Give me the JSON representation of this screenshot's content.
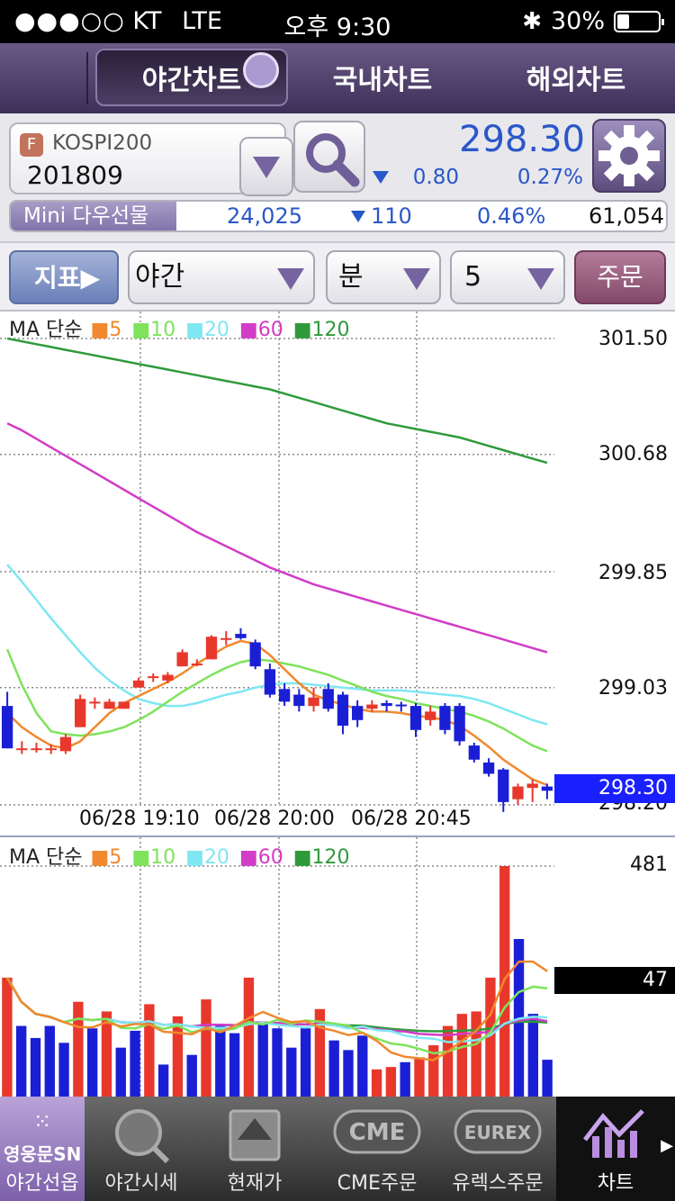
{
  "status": {
    "carrier": "KT",
    "network": "LTE",
    "time": "오후 9:30",
    "battery": "30%",
    "battery_level": 0.3
  },
  "tabs": [
    {
      "label": "야간차트",
      "active": true
    },
    {
      "label": "국내차트",
      "active": false
    },
    {
      "label": "해외차트",
      "active": false
    }
  ],
  "quote": {
    "badge": "F",
    "market": "KOSPI200",
    "code": "201809",
    "price": "298.30",
    "change": "0.80",
    "change_pct": "0.27%",
    "direction": "down",
    "ticker": {
      "label": "Mini 다우선물",
      "value": "24,025",
      "change": "110",
      "change_pct": "0.46%",
      "volume": "61,054"
    }
  },
  "toolbar": {
    "indicator": "지표▶",
    "session": "야간",
    "unit": "분",
    "interval": "5",
    "order": "주문"
  },
  "colors": {
    "up": "#e8382c",
    "down": "#1a1fd6",
    "ma5": "#f0892e",
    "ma10": "#7ee35b",
    "ma20": "#7fe7f2",
    "ma60": "#d23cc7",
    "ma120": "#2f9a3c",
    "current": "#1a1fff"
  },
  "price_chart": {
    "legend": {
      "title": "MA 단순",
      "items": [
        "5",
        "10",
        "20",
        "60",
        "120"
      ]
    },
    "y_labels": [
      "301.50",
      "300.68",
      "299.85",
      "299.03",
      "298.20"
    ],
    "current": "298.30",
    "x_labels": [
      "06/28 19:10",
      "06/28 20:00",
      "06/28 20:45"
    ]
  },
  "volume_chart": {
    "legend": {
      "title": "MA 단순",
      "items": [
        "5",
        "10",
        "20",
        "60",
        "120"
      ]
    },
    "y_labels": [
      "481"
    ],
    "current": "47"
  },
  "chart_data": [
    {
      "type": "candlestick",
      "title": "MA 단순",
      "ylim": [
        298.2,
        301.5
      ],
      "ohlc": [
        [
          298.9,
          299.0,
          298.6,
          298.6
        ],
        [
          298.6,
          298.65,
          298.56,
          298.6
        ],
        [
          298.6,
          298.64,
          298.57,
          298.6
        ],
        [
          298.6,
          298.63,
          298.56,
          298.6
        ],
        [
          298.58,
          298.7,
          298.56,
          298.68
        ],
        [
          298.75,
          298.98,
          298.75,
          298.95
        ],
        [
          298.92,
          298.96,
          298.88,
          298.93
        ],
        [
          298.88,
          298.95,
          298.88,
          298.93
        ],
        [
          298.88,
          298.93,
          298.88,
          298.93
        ],
        [
          299.03,
          299.1,
          299.03,
          299.08
        ],
        [
          299.1,
          299.13,
          299.07,
          299.11
        ],
        [
          299.08,
          299.14,
          299.06,
          299.12
        ],
        [
          299.18,
          299.3,
          299.18,
          299.28
        ],
        [
          299.2,
          299.23,
          299.18,
          299.2
        ],
        [
          299.23,
          299.4,
          299.23,
          299.39
        ],
        [
          299.37,
          299.43,
          299.33,
          299.38
        ],
        [
          299.41,
          299.45,
          299.37,
          299.38
        ],
        [
          299.35,
          299.37,
          299.16,
          299.18
        ],
        [
          299.16,
          299.2,
          298.96,
          298.98
        ],
        [
          299.02,
          299.06,
          298.9,
          298.93
        ],
        [
          298.98,
          299.02,
          298.86,
          298.9
        ],
        [
          298.9,
          299.03,
          298.86,
          298.96
        ],
        [
          299.02,
          299.06,
          298.86,
          298.88
        ],
        [
          298.98,
          299.0,
          298.7,
          298.76
        ],
        [
          298.9,
          298.94,
          298.75,
          298.8
        ],
        [
          298.88,
          298.94,
          298.86,
          298.91
        ],
        [
          298.92,
          298.94,
          298.86,
          298.9
        ],
        [
          298.91,
          298.93,
          298.86,
          298.9
        ],
        [
          298.9,
          298.92,
          298.68,
          298.73
        ],
        [
          298.8,
          298.9,
          298.76,
          298.86
        ],
        [
          298.9,
          298.92,
          298.7,
          298.73
        ],
        [
          298.9,
          298.92,
          298.62,
          298.65
        ],
        [
          298.62,
          298.64,
          298.5,
          298.52
        ],
        [
          298.5,
          298.53,
          298.4,
          298.42
        ],
        [
          298.45,
          298.46,
          298.15,
          298.22
        ],
        [
          298.24,
          298.35,
          298.2,
          298.33
        ],
        [
          298.32,
          298.38,
          298.22,
          298.35
        ],
        [
          298.33,
          298.35,
          298.24,
          298.3
        ]
      ],
      "ma": {
        "5": [
          298.85,
          298.75,
          298.68,
          298.62,
          298.6,
          298.65,
          298.75,
          298.85,
          298.92,
          298.97,
          299.02,
          299.07,
          299.13,
          299.2,
          299.26,
          299.32,
          299.36,
          299.34,
          299.26,
          299.16,
          299.06,
          298.98,
          298.94,
          298.91,
          298.88,
          298.86,
          298.86,
          298.85,
          298.83,
          298.82,
          298.8,
          298.76,
          298.69,
          298.61,
          298.52,
          298.45,
          298.38,
          298.34
        ],
        "10": [
          299.3,
          299.05,
          298.85,
          298.72,
          298.7,
          298.69,
          298.7,
          298.72,
          298.75,
          298.8,
          298.86,
          298.93,
          299.0,
          299.06,
          299.12,
          299.17,
          299.21,
          299.23,
          299.22,
          299.2,
          299.18,
          299.15,
          299.12,
          299.08,
          299.04,
          299.0,
          298.97,
          298.95,
          298.92,
          298.9,
          298.88,
          298.86,
          298.83,
          298.79,
          298.74,
          298.68,
          298.62,
          298.58
        ],
        "20": [
          299.9,
          299.78,
          299.65,
          299.52,
          299.4,
          299.28,
          299.17,
          299.08,
          299.01,
          298.95,
          298.92,
          298.9,
          298.9,
          298.92,
          298.95,
          298.98,
          299.0,
          299.03,
          299.05,
          299.06,
          299.06,
          299.05,
          299.04,
          299.03,
          299.02,
          299.01,
          299.01,
          299.01,
          299.0,
          298.99,
          298.98,
          298.97,
          298.95,
          298.92,
          298.88,
          298.84,
          298.8,
          298.77
        ],
        "60": [
          300.9,
          300.85,
          300.79,
          300.73,
          300.67,
          300.61,
          300.55,
          300.49,
          300.43,
          300.37,
          300.31,
          300.25,
          300.19,
          300.13,
          300.08,
          300.03,
          299.98,
          299.93,
          299.88,
          299.84,
          299.8,
          299.76,
          299.73,
          299.7,
          299.67,
          299.64,
          299.61,
          299.58,
          299.55,
          299.52,
          299.49,
          299.46,
          299.43,
          299.4,
          299.37,
          299.34,
          299.31,
          299.28
        ],
        "120": [
          301.5,
          301.48,
          301.46,
          301.44,
          301.42,
          301.4,
          301.38,
          301.36,
          301.34,
          301.32,
          301.3,
          301.28,
          301.26,
          301.24,
          301.22,
          301.2,
          301.18,
          301.16,
          301.14,
          301.11,
          301.08,
          301.05,
          301.02,
          300.99,
          300.96,
          300.93,
          300.9,
          300.88,
          300.86,
          300.84,
          300.82,
          300.8,
          300.77,
          300.74,
          300.71,
          300.68,
          300.65,
          300.62
        ]
      }
    },
    {
      "type": "bar",
      "title": "MA 단순",
      "ylim": [
        0,
        481
      ],
      "values": [
        250,
        150,
        125,
        150,
        115,
        200,
        145,
        180,
        105,
        140,
        195,
        70,
        170,
        90,
        205,
        150,
        135,
        250,
        155,
        145,
        105,
        145,
        185,
        120,
        100,
        130,
        60,
        65,
        75,
        85,
        110,
        150,
        175,
        180,
        250,
        481,
        330,
        175,
        80
      ],
      "directions": [
        "up",
        "down",
        "down",
        "down",
        "down",
        "up",
        "down",
        "up",
        "down",
        "down",
        "up",
        "down",
        "up",
        "down",
        "up",
        "down",
        "down",
        "up",
        "down",
        "down",
        "down",
        "down",
        "up",
        "down",
        "down",
        "down",
        "up",
        "up",
        "down",
        "up",
        "up",
        "up",
        "up",
        "up",
        "up",
        "up",
        "down",
        "down",
        "down"
      ]
    }
  ]
}
